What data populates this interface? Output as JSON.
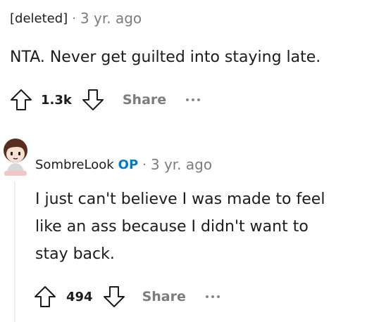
{
  "comment1": {
    "author": "[deleted]",
    "separator": "·",
    "time": "3 yr. ago",
    "body": "NTA. Never get guilted into staying late.",
    "score": "1.3k",
    "share_label": "Share",
    "upvote_icon": "upvote-arrow-icon",
    "downvote_icon": "downvote-arrow-icon"
  },
  "comment2": {
    "author": "SombreLook",
    "op_badge": "OP",
    "separator": "·",
    "time": "3 yr. ago",
    "body_lines": [
      "I just can't believe I was made to feel",
      "like an ass because I didn't want to",
      "stay back."
    ],
    "score": "494",
    "share_label": "Share",
    "colors": {
      "op": "#0079d3",
      "muted": "#7c7c7c"
    }
  }
}
